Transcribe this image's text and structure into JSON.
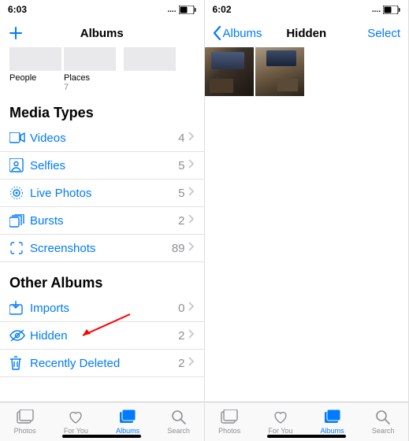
{
  "left": {
    "time": "6:03",
    "nav_title": "Albums",
    "albums": [
      {
        "name": "People",
        "count": ""
      },
      {
        "name": "Places",
        "count": "7"
      }
    ],
    "section_media": "Media Types",
    "media_rows": [
      {
        "icon": "video",
        "label": "Videos",
        "count": "4"
      },
      {
        "icon": "selfie",
        "label": "Selfies",
        "count": "5"
      },
      {
        "icon": "live",
        "label": "Live Photos",
        "count": "5"
      },
      {
        "icon": "burst",
        "label": "Bursts",
        "count": "2"
      },
      {
        "icon": "screenshot",
        "label": "Screenshots",
        "count": "89"
      }
    ],
    "section_other": "Other Albums",
    "other_rows": [
      {
        "icon": "import",
        "label": "Imports",
        "count": "0"
      },
      {
        "icon": "hidden",
        "label": "Hidden",
        "count": "2"
      },
      {
        "icon": "trash",
        "label": "Recently Deleted",
        "count": "2"
      }
    ]
  },
  "right": {
    "time": "6:02",
    "back": "Albums",
    "nav_title": "Hidden",
    "select": "Select"
  },
  "tabs": [
    {
      "label": "Photos"
    },
    {
      "label": "For You"
    },
    {
      "label": "Albums"
    },
    {
      "label": "Search"
    }
  ]
}
